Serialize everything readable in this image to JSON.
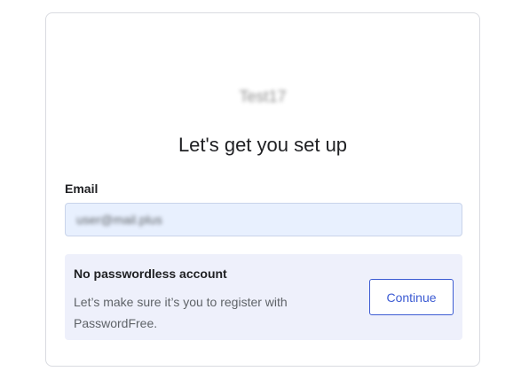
{
  "brand": {
    "logo_text": "Test17"
  },
  "heading": "Let's get you set up",
  "email": {
    "label": "Email",
    "value": "user@mail.plus"
  },
  "notice": {
    "title": "No passwordless account",
    "body": "Let’s make sure it’s you to register with PasswordFree.",
    "button_label": "Continue"
  },
  "colors": {
    "accent": "#3c5bd3",
    "input_bg": "#e8f0fe",
    "notice_bg": "#eef0fb"
  }
}
